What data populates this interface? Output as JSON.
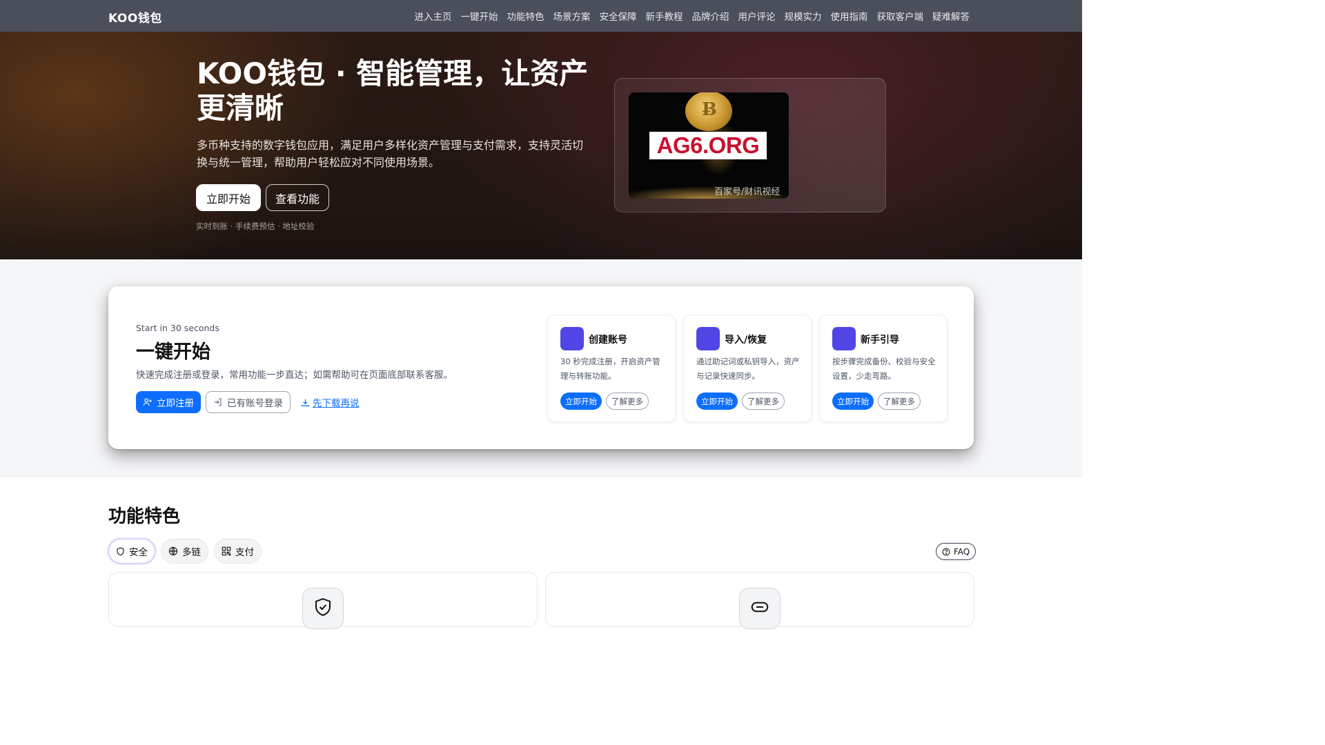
{
  "nav": {
    "brand": "KOO钱包",
    "links": [
      "进入主页",
      "一键开始",
      "功能特色",
      "场景方案",
      "安全保障",
      "新手教程",
      "品牌介绍",
      "用户评论",
      "规模实力",
      "使用指南",
      "获取客户端",
      "疑难解答"
    ]
  },
  "hero": {
    "title": "KOO钱包 · 智能管理，让资产更清晰",
    "desc": "多币种支持的数字钱包应用，满足用户多样化资产管理与支付需求，支持灵活切换与统一管理，帮助用户轻松应对不同使用场景。",
    "primary_btn": "立即开始",
    "secondary_btn": "查看功能",
    "note": "实时到账 · 手续费预估 · 地址校验",
    "image_text": "AG6.ORG",
    "image_watermark": "百家号/财讯视经"
  },
  "start": {
    "eyebrow": "Start in 30 seconds",
    "title": "一键开始",
    "desc": "快速完成注册或登录，常用功能一步直达；如需帮助可在页面底部联系客服。",
    "register_btn": "立即注册",
    "login_btn": "已有账号登录",
    "download_link": "先下载再说",
    "cards": [
      {
        "title": "创建账号",
        "desc": "30 秒完成注册，开启资产管理与转账功能。",
        "btn": "立即开始",
        "more": "了解更多"
      },
      {
        "title": "导入/恢复",
        "desc": "通过助记词或私钥导入，资产与记录快速同步。",
        "btn": "立即开始",
        "more": "了解更多"
      },
      {
        "title": "新手引导",
        "desc": "按步骤完成备份、校验与安全设置，少走弯路。",
        "btn": "立即开始",
        "more": "了解更多"
      }
    ]
  },
  "features": {
    "title": "功能特色",
    "tabs": [
      "安全",
      "多链",
      "支付"
    ],
    "faq": "FAQ"
  },
  "colors": {
    "nav_bg": "#4b4f5c",
    "primary": "#0d6efd",
    "card_icon": "#4f46e5"
  }
}
